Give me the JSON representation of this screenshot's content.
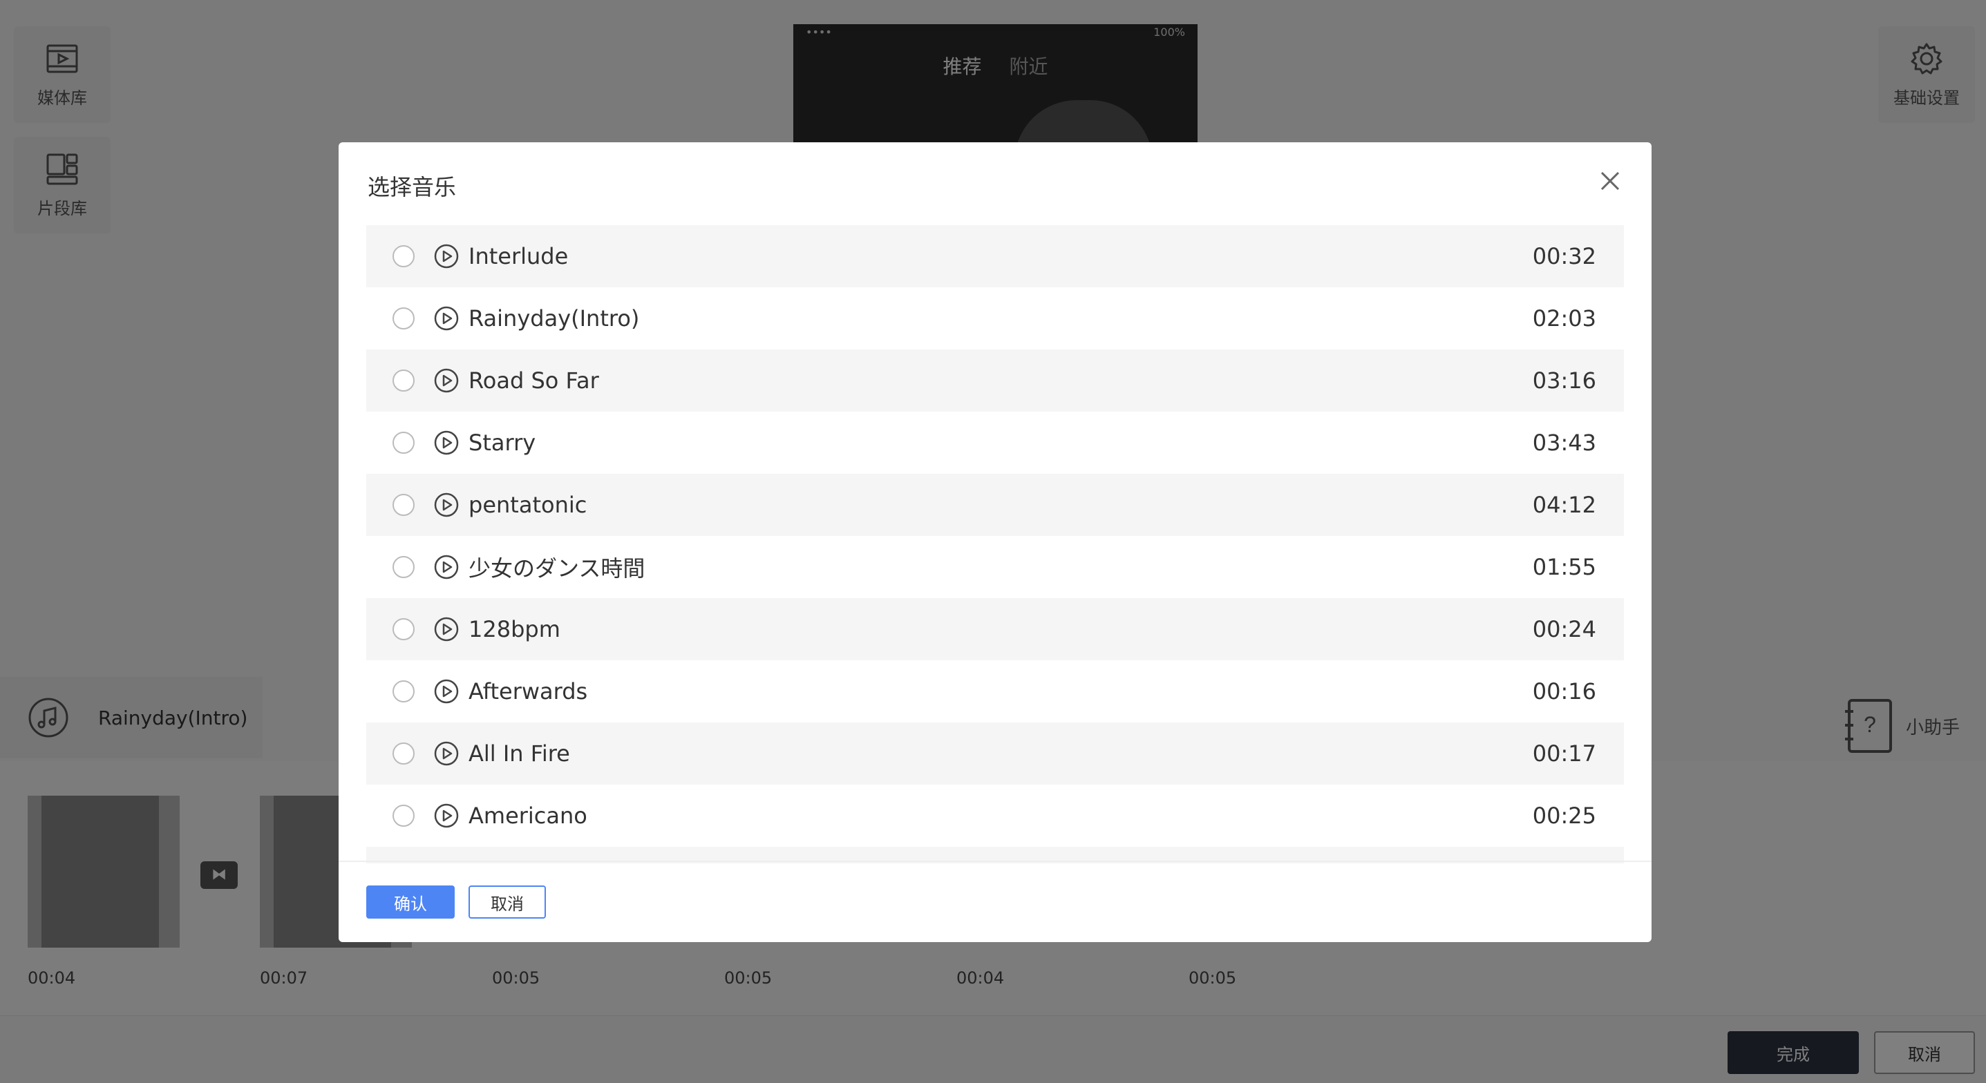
{
  "sidebar": {
    "media_library": "媒体库",
    "clip_library": "片段库",
    "basic_settings": "基础设置",
    "helper": "小助手"
  },
  "preview": {
    "status_signal": "••••",
    "status_battery": "100%",
    "tab_recommend": "推荐",
    "tab_nearby": "附近"
  },
  "current_music": "Rainyday(Intro)",
  "timeline": {
    "clip_times": [
      "00:04",
      "00:07",
      "00:05",
      "00:05",
      "00:04",
      "00:05"
    ]
  },
  "footer": {
    "done": "完成",
    "cancel": "取消"
  },
  "dialog": {
    "title": "选择音乐",
    "confirm": "确认",
    "cancel": "取消",
    "tracks": [
      {
        "name": "Interlude",
        "duration": "00:32"
      },
      {
        "name": "Rainyday(Intro)",
        "duration": "02:03"
      },
      {
        "name": "Road So Far",
        "duration": "03:16"
      },
      {
        "name": "Starry",
        "duration": "03:43"
      },
      {
        "name": "pentatonic",
        "duration": "04:12"
      },
      {
        "name": "少女のダンス時間",
        "duration": "01:55"
      },
      {
        "name": "128bpm",
        "duration": "00:24"
      },
      {
        "name": "Afterwards",
        "duration": "00:16"
      },
      {
        "name": "All In Fire",
        "duration": "00:17"
      },
      {
        "name": "Americano",
        "duration": "00:25"
      }
    ]
  },
  "colors": {
    "primary": "#4e85f5",
    "dark_button": "#2c3340"
  }
}
